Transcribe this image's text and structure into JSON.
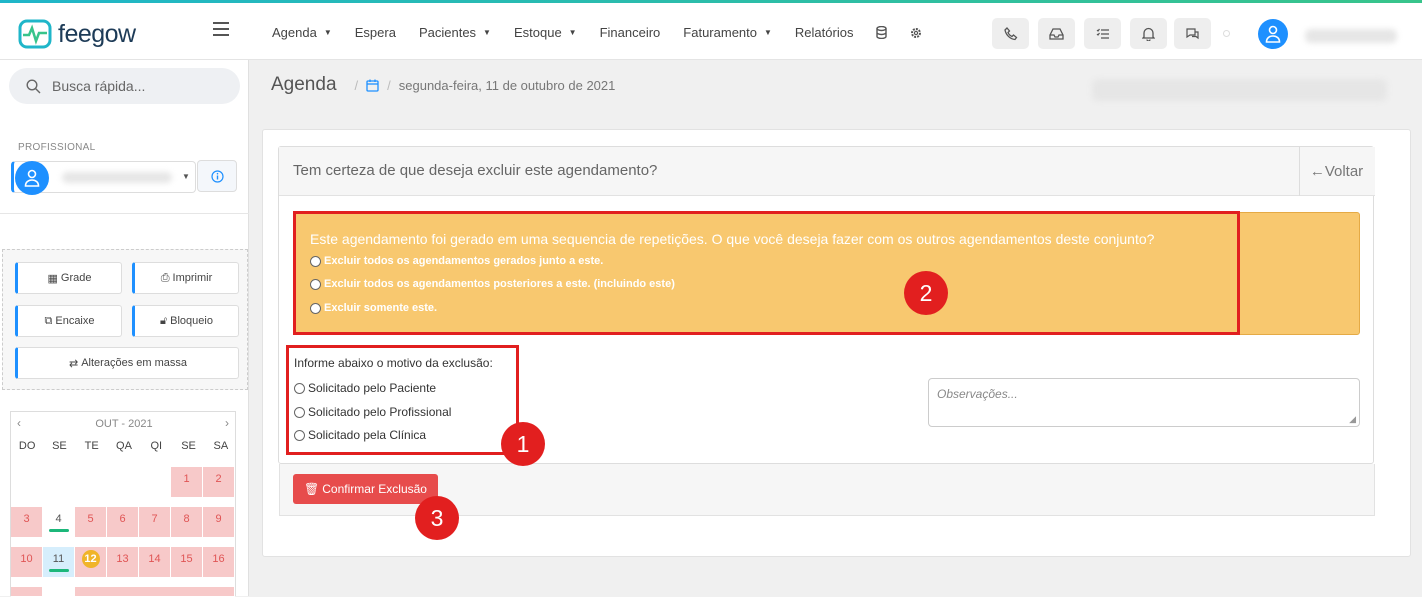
{
  "brand": {
    "name": "feegow"
  },
  "nav": {
    "items": [
      {
        "label": "Agenda",
        "caret": true
      },
      {
        "label": "Espera",
        "caret": false
      },
      {
        "label": "Pacientes",
        "caret": true
      },
      {
        "label": "Estoque",
        "caret": true
      },
      {
        "label": "Financeiro",
        "caret": false
      },
      {
        "label": "Faturamento",
        "caret": true
      },
      {
        "label": "Relatórios",
        "caret": false
      }
    ]
  },
  "sidebar": {
    "search_placeholder": "Busca rápida...",
    "profissional_label": "PROFISSIONAL",
    "actions": {
      "grade": "Grade",
      "imprimir": "Imprimir",
      "encaixe": "Encaixe",
      "bloqueio": "Bloqueio",
      "alteracoes": "Alterações em massa"
    },
    "calendar": {
      "month": "OUT - 2021",
      "dows": [
        "DO",
        "SE",
        "TE",
        "QA",
        "QI",
        "SE",
        "SA"
      ],
      "days": [
        "1",
        "2",
        "3",
        "4",
        "5",
        "6",
        "7",
        "8",
        "9",
        "10",
        "11",
        "12",
        "13",
        "14",
        "15",
        "16"
      ]
    }
  },
  "breadcrumb": {
    "title": "Agenda",
    "date": "segunda-feira, 11 de outubro de 2021"
  },
  "dialog": {
    "title": "Tem certeza de que deseja excluir este agendamento?",
    "back": "Voltar",
    "warning": "Este agendamento foi gerado em uma sequencia de repetições. O que você deseja fazer com os outros agendamentos deste conjunto?",
    "options": [
      "Excluir todos os agendamentos gerados junto a este.",
      "Excluir todos os agendamentos posteriores a este. (incluindo este)",
      "Excluir somente este."
    ],
    "reason_label": "Informe abaixo o motivo da exclusão:",
    "reasons": [
      "Solicitado pelo Paciente",
      "Solicitado pelo Profissional",
      "Solicitado pela Clínica"
    ],
    "obs_placeholder": "Observações...",
    "confirm": "Confirmar Exclusão"
  },
  "annotations": [
    "1",
    "2",
    "3"
  ],
  "colors": {
    "accent": "#1e90ff",
    "warning": "#f8c86f",
    "danger": "#e74c4c",
    "highlight": "#e11f1f"
  }
}
